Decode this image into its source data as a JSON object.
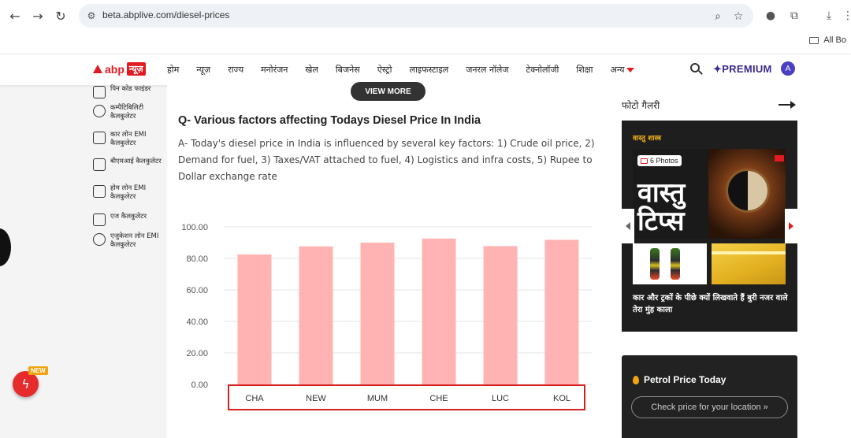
{
  "browser": {
    "url": "beta.abplive.com/diesel-prices",
    "bookmarks_label": "All Bo"
  },
  "header": {
    "logo_abp": "abp",
    "logo_news": "न्यूज़",
    "menu": [
      "होम",
      "न्यूज़",
      "राज्य",
      "मनोरंजन",
      "खेल",
      "बिजनेस",
      "ऐस्ट्रो",
      "लाइफस्टाइल",
      "जनरल नॉलेज",
      "टेक्नोलॉजी",
      "शिक्षा",
      "अन्य"
    ],
    "premium_label": "✦PREMIUM",
    "avatar_letter": "A"
  },
  "sidebar": {
    "tools": [
      {
        "label": "पिन कोड फाइंडर",
        "icon": "pin-search-icon"
      },
      {
        "label": "कम्पैटिबिलिटी कैलकुलेटर",
        "icon": "heart-calculator-icon"
      },
      {
        "label": "कार लोन EMI कैलकुलेटर",
        "icon": "car-icon"
      },
      {
        "label": "बीएमआई कैलकुलेटर",
        "icon": "bmi-icon"
      },
      {
        "label": "होम लोन EMI कैलकुलेटर",
        "icon": "home-icon"
      },
      {
        "label": "एज कैलकुलेटर",
        "icon": "calendar-icon"
      },
      {
        "label": "एजुकेशन लोन EMI कैलकुलेटर",
        "icon": "education-icon"
      }
    ],
    "fab_badge": "NEW"
  },
  "main": {
    "view_more": "VIEW MORE",
    "question": "Q- Various factors affecting Todays Diesel Price In India",
    "answer": "A- Today's diesel price in India is influenced by several key factors: 1) Crude oil price, 2) Demand for fuel, 3) Taxes/VAT attached to fuel, 4) Logistics and infra costs, 5) Rupee to Dollar exchange rate"
  },
  "chart_data": {
    "type": "bar",
    "categories": [
      "CHA",
      "NEW",
      "MUM",
      "CHE",
      "LUC",
      "KOL"
    ],
    "values": [
      82.5,
      87.6,
      90.0,
      92.6,
      87.8,
      91.8
    ],
    "yticks": [
      "0.00",
      "20.00",
      "40.00",
      "60.00",
      "80.00",
      "100.00"
    ],
    "ylim": [
      0,
      100
    ],
    "bar_color": "#ffb3b3",
    "highlight_color": "#d62020"
  },
  "right": {
    "photo_title": "फोटो गैलरी",
    "gallery_category": "वास्तु शास्त्र",
    "gallery_photos_label": "6 Photos",
    "gallery_main_title": "वास्तु टिप्स",
    "gallery_caption": "कार और ट्रकों के पीछे क्यों लिखवाते हैं बुरी नजर वाले तेरा मुंह काला",
    "petrol_title": "Petrol Price Today",
    "petrol_button": "Check price for your location »"
  }
}
